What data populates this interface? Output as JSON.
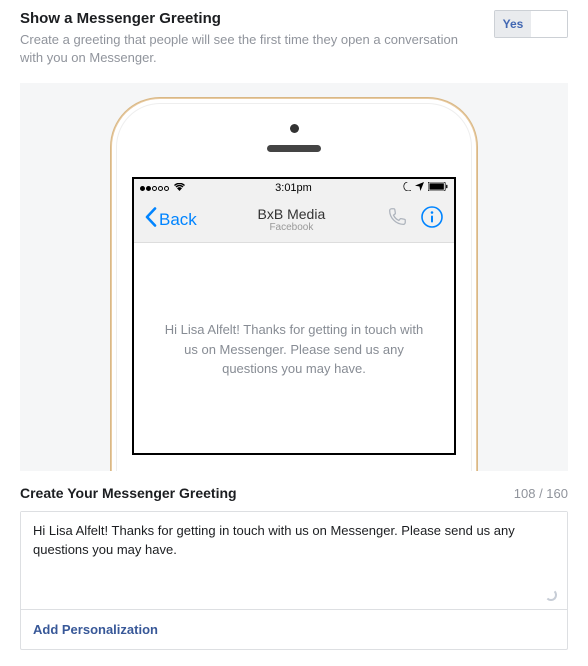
{
  "header": {
    "title": "Show a Messenger Greeting",
    "subtitle": "Create a greeting that people will see the first time they open a conversation with you on Messenger."
  },
  "toggle": {
    "yes": "Yes",
    "no": ""
  },
  "phone": {
    "status_time": "3:01pm",
    "back_label": "Back",
    "chat_title": "BxB Media",
    "chat_subtitle": "Facebook",
    "greeting_preview": "Hi Lisa Alfelt! Thanks for getting in touch with us on Messenger. Please send us any questions you may have."
  },
  "editor": {
    "title": "Create Your Messenger Greeting",
    "char_count": "108 / 160",
    "value": "Hi Lisa Alfelt! Thanks for getting in touch with us on Messenger. Please send us any questions you may have.",
    "add_personalization": "Add Personalization"
  }
}
